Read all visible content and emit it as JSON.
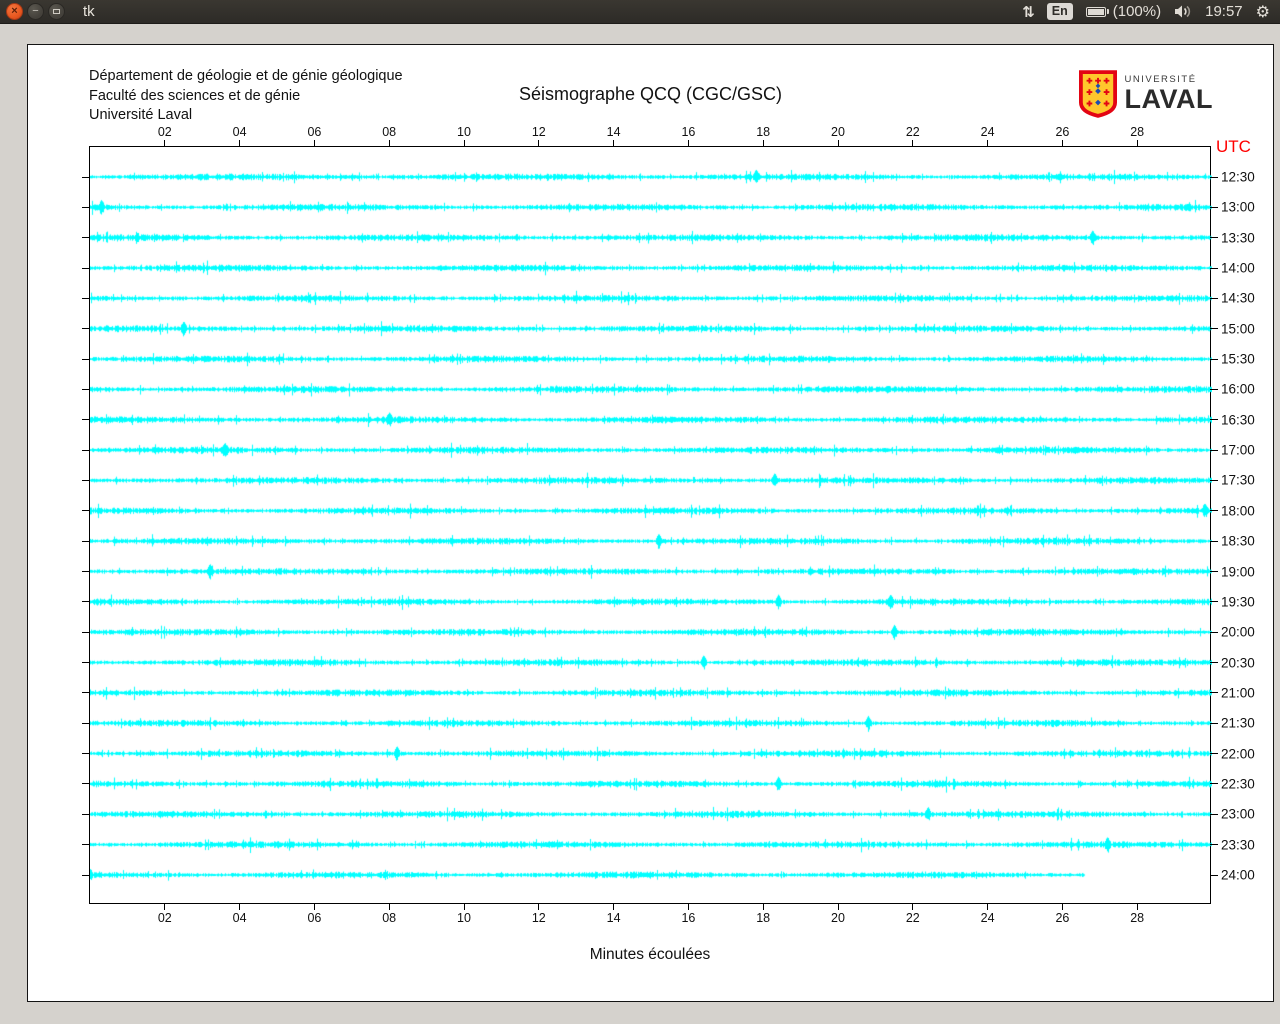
{
  "panel": {
    "title": "tk",
    "window_controls": {
      "close": "×",
      "minimize": "−"
    },
    "tray": {
      "keyboard_layout": "En",
      "battery_percent": "(100%)",
      "clock": "19:57"
    }
  },
  "header": {
    "address_lines": [
      "Département de géologie et de génie géologique",
      "Faculté des sciences et de génie",
      "Université Laval"
    ],
    "logo": {
      "small": "UNIVERSITÉ",
      "large": "LAVAL"
    }
  },
  "chart_data": {
    "type": "line",
    "title": "Séismographe QCQ (CGC/GSC)",
    "xlabel": "Minutes écoulées",
    "right_axis_title": "UTC",
    "xlim": [
      0,
      30
    ],
    "x_ticks": [
      2,
      4,
      6,
      8,
      10,
      12,
      14,
      16,
      18,
      20,
      22,
      24,
      26,
      28
    ],
    "x_tick_labels": [
      "02",
      "04",
      "06",
      "08",
      "10",
      "12",
      "14",
      "16",
      "18",
      "20",
      "22",
      "24",
      "26",
      "28"
    ],
    "trace_color": "#00ffff",
    "utc_label_color": "#ff0000",
    "rows": [
      {
        "utc": "12:30",
        "end_minute": 30,
        "spikes": [
          17.8
        ]
      },
      {
        "utc": "13:00",
        "end_minute": 30,
        "spikes": [
          0.3
        ]
      },
      {
        "utc": "13:30",
        "end_minute": 30,
        "spikes": [
          26.8
        ]
      },
      {
        "utc": "14:00",
        "end_minute": 30,
        "spikes": []
      },
      {
        "utc": "14:30",
        "end_minute": 30,
        "spikes": []
      },
      {
        "utc": "15:00",
        "end_minute": 30,
        "spikes": [
          2.5
        ]
      },
      {
        "utc": "15:30",
        "end_minute": 30,
        "spikes": []
      },
      {
        "utc": "16:00",
        "end_minute": 30,
        "spikes": []
      },
      {
        "utc": "16:30",
        "end_minute": 30,
        "spikes": [
          8.0
        ]
      },
      {
        "utc": "17:00",
        "end_minute": 30,
        "spikes": [
          3.6
        ]
      },
      {
        "utc": "17:30",
        "end_minute": 30,
        "spikes": [
          18.3
        ]
      },
      {
        "utc": "18:00",
        "end_minute": 30,
        "spikes": [
          29.8
        ]
      },
      {
        "utc": "18:30",
        "end_minute": 30,
        "spikes": [
          15.2
        ]
      },
      {
        "utc": "19:00",
        "end_minute": 30,
        "spikes": [
          3.2
        ]
      },
      {
        "utc": "19:30",
        "end_minute": 30,
        "spikes": [
          18.4,
          21.4
        ]
      },
      {
        "utc": "20:00",
        "end_minute": 30,
        "spikes": [
          21.5
        ]
      },
      {
        "utc": "20:30",
        "end_minute": 30,
        "spikes": [
          16.4
        ]
      },
      {
        "utc": "21:00",
        "end_minute": 30,
        "spikes": []
      },
      {
        "utc": "21:30",
        "end_minute": 30,
        "spikes": [
          20.8
        ]
      },
      {
        "utc": "22:00",
        "end_minute": 30,
        "spikes": [
          8.2
        ]
      },
      {
        "utc": "22:30",
        "end_minute": 30,
        "spikes": [
          18.4
        ]
      },
      {
        "utc": "23:00",
        "end_minute": 30,
        "spikes": [
          22.4
        ]
      },
      {
        "utc": "23:30",
        "end_minute": 30,
        "spikes": [
          27.2
        ]
      },
      {
        "utc": "24:00",
        "end_minute": 26.6,
        "spikes": []
      }
    ]
  }
}
